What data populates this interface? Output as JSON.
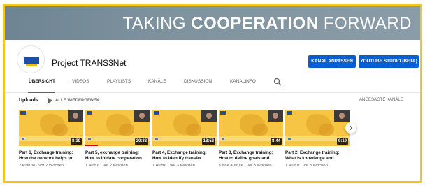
{
  "banner": {
    "text_light": "TAKING ",
    "text_bold": "COOPERATION",
    "text_end": " FORWARD"
  },
  "channel": {
    "name": "Project TRANS3Net",
    "avatar_icon": "trans3net-logo-icon",
    "buttons": {
      "customize": "KANAL ANPASSEN",
      "studio": "YOUTUBE STUDIO (BETA)"
    }
  },
  "tabs": [
    {
      "label": "ÜBERSICHT",
      "active": true
    },
    {
      "label": "VIDEOS"
    },
    {
      "label": "PLAYLISTS"
    },
    {
      "label": "KANÄLE"
    },
    {
      "label": "DISKUSSION"
    },
    {
      "label": "KANALINFO"
    }
  ],
  "uploads": {
    "heading": "Uploads",
    "play_all": "ALLE WIEDERGEBEN",
    "featured_channels": "ANGESAGTE KANÄLE",
    "videos": [
      {
        "title": "Part 6, Exchange training: How the network helps to",
        "duration": "8:30",
        "meta": "2 Aufrufe · vor 2 Wochen",
        "progress": 0
      },
      {
        "title": "Part 5, exchange training: How to initiate cooperation",
        "duration": "20:38",
        "meta": "1 Aufruf · vor 2 Wochen",
        "progress": 0.2
      },
      {
        "title": "Part 4, Exchange training: How to identify transfer",
        "duration": "18:52",
        "meta": "1 Aufruf · vor 3 Wochen",
        "progress": 0
      },
      {
        "title": "Part 3, Exchange training: How to define goals and",
        "duration": "8:44",
        "meta": "Keine Aufrufe · vor 3 Wochen",
        "progress": 0
      },
      {
        "title": "Part 2, Exchange training: What is knowledge and",
        "duration": "9:19",
        "meta": "1 Aufruf · vor 3 Wochen",
        "progress": 0
      }
    ]
  },
  "colors": {
    "frame": "#f5c518",
    "button": "#065fd4",
    "thumb": "#f6c544",
    "progress": "#e00000"
  }
}
